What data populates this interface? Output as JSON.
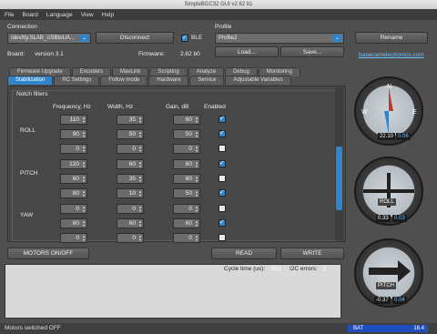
{
  "title": "SimpleBGC32 GUI v2.62 b1",
  "menu": [
    "File",
    "Board",
    "Language",
    "View",
    "Help"
  ],
  "connection": {
    "label": "Connection",
    "port": "/dev/tty.SLAB_USBtoUA...",
    "disconnect": "Disconnect",
    "ble": "BLE",
    "board_label": "Board:",
    "board_version": "version 3.1",
    "firmware_label": "Firmware:",
    "firmware": "2.62 b0"
  },
  "profile": {
    "label": "Profile",
    "value": "Profile2",
    "load": "Load...",
    "save": "Save...",
    "rename": "Rename",
    "link": "basecamelectronics.com"
  },
  "tabs_top": [
    "Firmware Upgrade",
    "Encoders",
    "MavLink",
    "Scripting",
    "Analyze",
    "Debug",
    "Monitoring"
  ],
  "tabs_bottom": [
    "Stabilization",
    "RC Settings",
    "Follow mode",
    "Hardware",
    "Service",
    "Adjustable Variables"
  ],
  "notch": {
    "title": "Notch filters",
    "headers": [
      "Frequency, Hz",
      "Width, Hz",
      "Gain, dB",
      "Enabled"
    ],
    "axes": [
      "ROLL",
      "PITCH",
      "YAW"
    ],
    "rows": [
      [
        "110",
        "35",
        "60",
        true
      ],
      [
        "90",
        "50",
        "50",
        true
      ],
      [
        "0",
        "0",
        "0",
        false
      ],
      [
        "120",
        "60",
        "60",
        true
      ],
      [
        "60",
        "35",
        "80",
        false
      ],
      [
        "80",
        "10",
        "50",
        true
      ],
      [
        "0",
        "0",
        "0",
        false
      ],
      [
        "80",
        "60",
        "60",
        true
      ],
      [
        "0",
        "0",
        "0",
        false
      ]
    ]
  },
  "buttons": {
    "motors": "MOTORS ON/OFF",
    "read": "READ",
    "write": "WRITE"
  },
  "cycle": {
    "label": "Cycle time (us):",
    "value": "801",
    "i2c_label": "I2C errors:",
    "i2c_value": "1"
  },
  "status": "Motors switched OFF",
  "battery": {
    "label": "BAT",
    "value": "16.4"
  },
  "gauges": {
    "yaw": {
      "a": "22.10",
      "b": "0.06"
    },
    "roll": {
      "label": "ROLL",
      "a": "0.33",
      "b": "0.03"
    },
    "pitch": {
      "label": "PITCH",
      "a": "-0.37",
      "b": "0.04"
    }
  }
}
